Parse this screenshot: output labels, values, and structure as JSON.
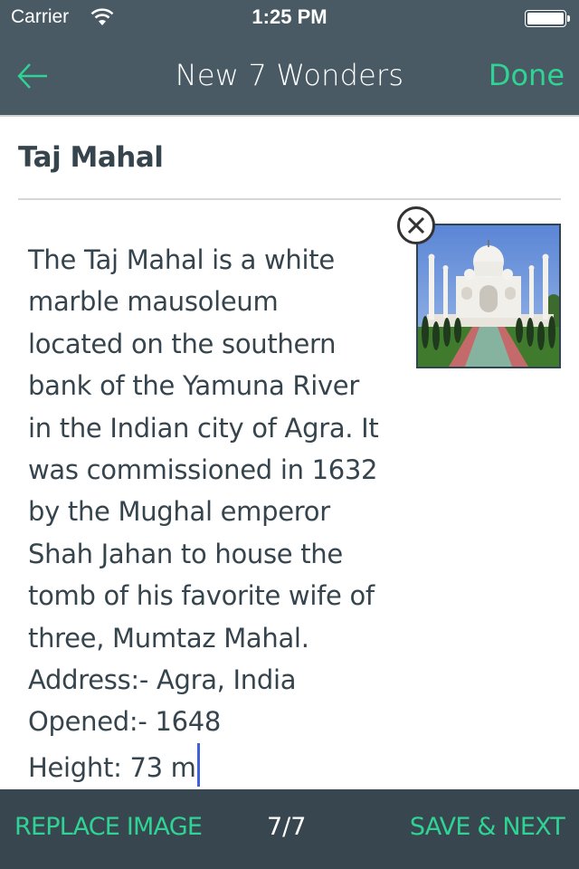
{
  "status_bar": {
    "carrier": "Carrier",
    "time": "1:25 PM",
    "icons": [
      "wifi-icon",
      "battery-icon"
    ]
  },
  "nav": {
    "back_icon": "arrow-left-icon",
    "title": "New 7 Wonders",
    "done_label": "Done"
  },
  "entry": {
    "title": "Taj Mahal",
    "description": "The Taj Mahal is a white\nmarble mausoleum\nlocated on the southern\nbank of the Yamuna River\nin the Indian city of Agra. It\nwas commissioned in 1632\nby the Mughal emperor\nShah Jahan to house the\ntomb of his favorite wife of\nthree, Mumtaz Mahal.\nAddress:- Agra, India\nOpened:- 1648\nHeight: 73 m",
    "image_alt": "Taj Mahal photo",
    "remove_image_icon": "close-circle-icon"
  },
  "bottom_bar": {
    "replace_label": "REPLACE IMAGE",
    "page_counter": "7/7",
    "save_next_label": "SAVE & NEXT"
  },
  "colors": {
    "nav_bg": "#495a64",
    "accent": "#2fd494",
    "bottom_bg": "#38474f",
    "text": "#36444d",
    "caret": "#3f62d9"
  }
}
